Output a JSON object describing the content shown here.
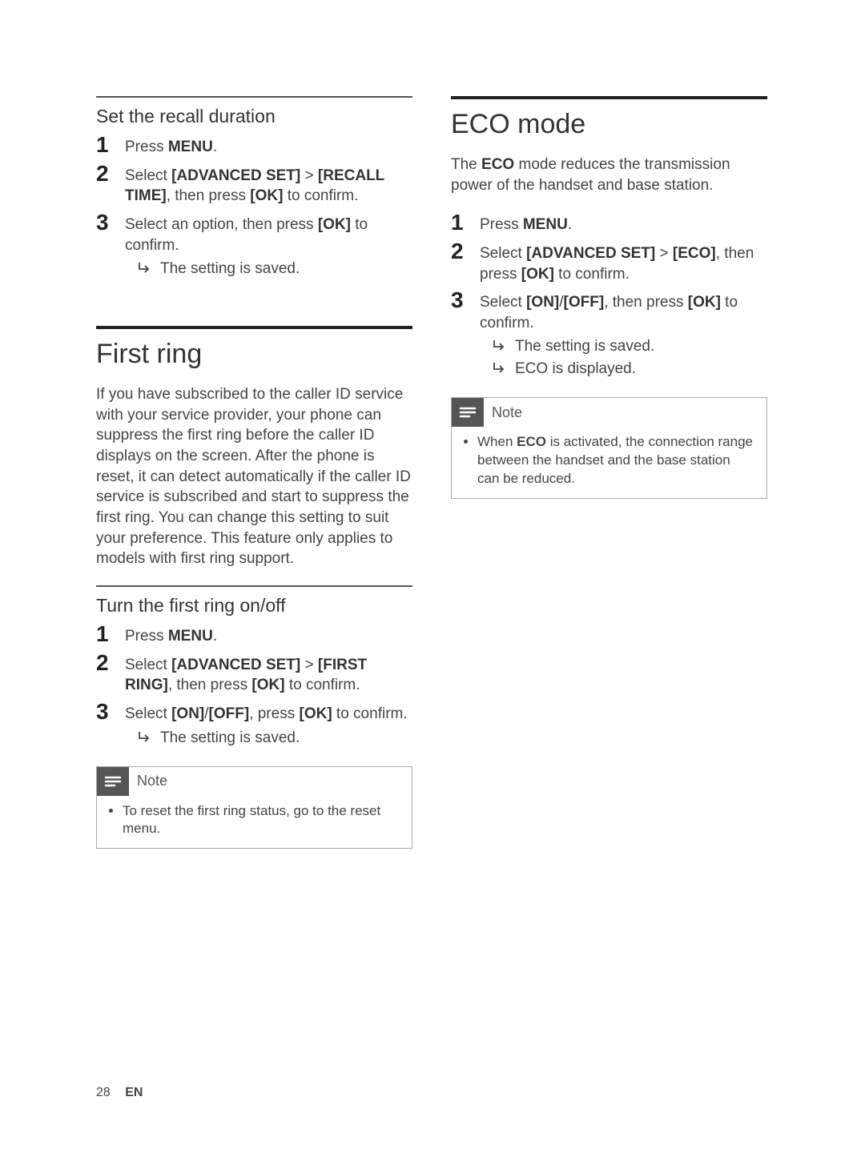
{
  "footer": {
    "page_num": "28",
    "lang": "EN"
  },
  "left": {
    "recall": {
      "title": "Set the recall duration",
      "step1_pre": "Press ",
      "step1_b": "MENU",
      "step1_post": ".",
      "step2_pre": "Select ",
      "step2_b1": "[ADVANCED SET]",
      "step2_mid": " > ",
      "step2_b2": "[RECALL TIME]",
      "step2_post1": ", then press ",
      "step2_b3": "[OK]",
      "step2_post2": " to confirm.",
      "step3_pre": "Select an option, then press ",
      "step3_b": "[OK]",
      "step3_post": " to confirm.",
      "result": "The setting is saved."
    },
    "firstring": {
      "heading": "First ring",
      "paragraph": "If you have subscribed to the caller ID service with your service provider, your phone can suppress the first ring before the caller ID displays on the screen. After the phone is reset, it can detect automatically if the caller ID service is subscribed and start to suppress the first ring. You can change this setting to suit your preference. This feature only applies to models with first ring support.",
      "sub_title": "Turn the first ring on/off",
      "step1_pre": "Press ",
      "step1_b": "MENU",
      "step1_post": ".",
      "step2_pre": "Select ",
      "step2_b1": "[ADVANCED SET]",
      "step2_mid": " > ",
      "step2_b2": "[FIRST RING]",
      "step2_post1": ", then press ",
      "step2_b3": "[OK]",
      "step2_post2": " to confirm.",
      "step3_pre": "Select ",
      "step3_b1": "[ON]",
      "step3_mid1": "/",
      "step3_b2": "[OFF]",
      "step3_mid2": ", press ",
      "step3_b3": "[OK]",
      "step3_post": " to confirm.",
      "result": "The setting is saved.",
      "note_label": "Note",
      "note_item": "To reset the first ring status, go to the reset menu."
    }
  },
  "right": {
    "eco": {
      "heading": "ECO mode",
      "para_pre": "The ",
      "para_b": "ECO",
      "para_post": " mode reduces the transmission power of the handset and base station.",
      "step1_pre": "Press ",
      "step1_b": "MENU",
      "step1_post": ".",
      "step2_pre": "Select ",
      "step2_b1": "[ADVANCED SET]",
      "step2_mid": " > ",
      "step2_b2": "[ECO]",
      "step2_post1": ", then press ",
      "step2_b3": "[OK]",
      "step2_post2": " to confirm.",
      "step3_pre": "Select ",
      "step3_b1": "[ON]",
      "step3_mid1": "/",
      "step3_b2": "[OFF]",
      "step3_mid2": ", then press ",
      "step3_b3": "[OK]",
      "step3_post": " to confirm.",
      "result1": "The setting is saved.",
      "result2_b": "ECO",
      "result2_post": " is displayed.",
      "note_label": "Note",
      "note_pre": "When ",
      "note_b": "ECO",
      "note_post": " is activated, the connection range between the handset and the base station can be reduced."
    }
  }
}
